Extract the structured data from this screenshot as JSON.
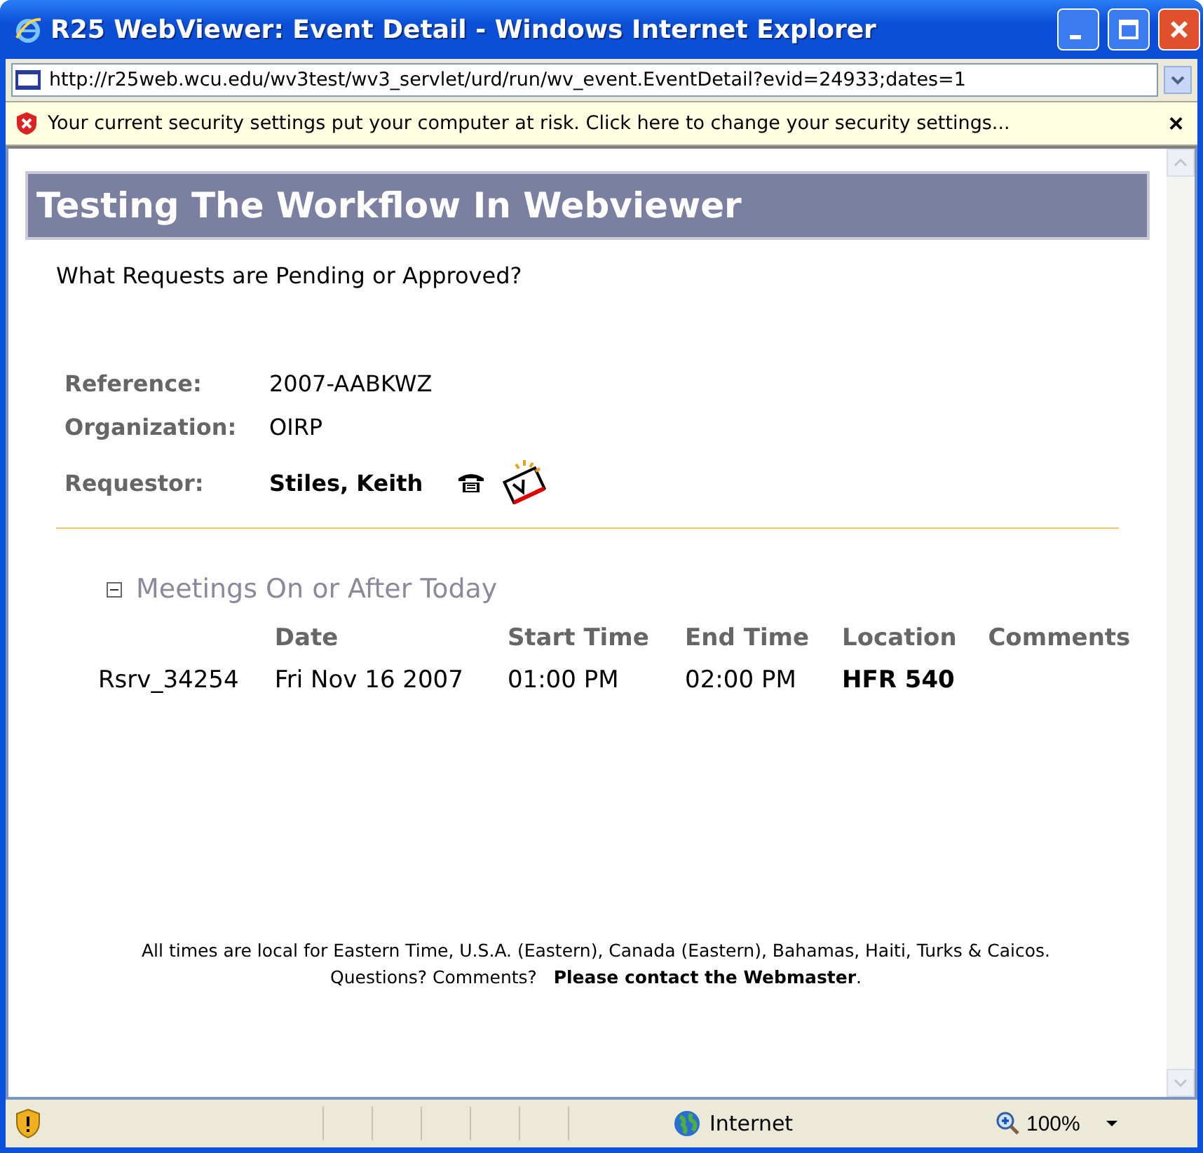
{
  "window": {
    "title": "R25 WebViewer: Event Detail - Windows Internet Explorer"
  },
  "address_bar": {
    "url": "http://r25web.wcu.edu/wv3test/wv3_servlet/urd/run/wv_event.EventDetail?evid=24933;dates=1"
  },
  "info_bar": {
    "message": "Your current security settings put your computer at risk. Click here to change your security settings...",
    "close": "×"
  },
  "page": {
    "heading": "Testing The Workflow In Webviewer",
    "description": "What Requests are Pending or Approved?",
    "details": [
      {
        "label": "Reference:",
        "value": "2007-AABKWZ",
        "kind": "plain"
      },
      {
        "label": "Organization:",
        "value": "OIRP",
        "kind": "plain"
      },
      {
        "label": "Requestor:",
        "value": "Stiles, Keith",
        "kind": "contact"
      }
    ],
    "meetings": {
      "title": "Meetings On or After Today",
      "expanded": true,
      "columns": [
        "Date",
        "Start Time",
        "End Time",
        "Location",
        "Comments"
      ],
      "rows": [
        {
          "id": "Rsrv_34254",
          "date": "Fri Nov 16 2007",
          "start": "01:00 PM",
          "end": "02:00 PM",
          "location": "HFR 540"
        }
      ]
    },
    "footer": [
      "All times are local for Eastern Time, U.S.A. (Eastern), Canada (Eastern), Bahamas, Haiti, Turks & Caicos.",
      "Questions? Comments?   **Please contact the Webmaster**."
    ]
  },
  "status_bar": {
    "zone": "Internet",
    "zoom": "100%"
  }
}
